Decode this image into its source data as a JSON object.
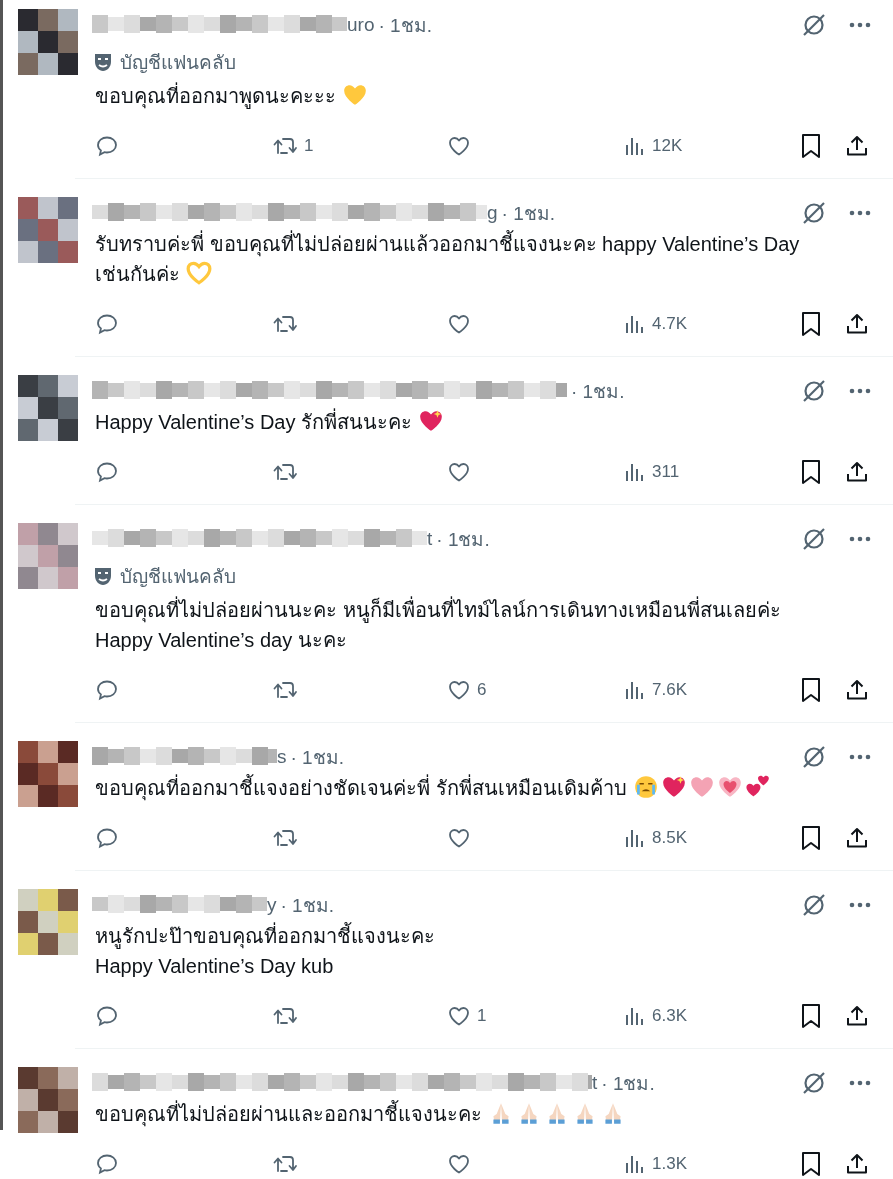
{
  "replies": [
    {
      "name_tail": "uro",
      "time": "· 1ชม.",
      "badge": "บัญชีแฟนคลับ",
      "lines": [
        "ขอบคุณที่ออกมาพูดนะคะะะ"
      ],
      "emoji": [
        {
          "kind": "heart",
          "color": "#ffc83d"
        }
      ],
      "reposts": "1",
      "views": "12K"
    },
    {
      "name_tail": "g",
      "time": "· 1ชม.",
      "lines": [
        "รับทราบค่ะพี่ ขอบคุณที่ไม่ปล่อยผ่านแล้วออกมาชี้แจงนะคะ happy Valentine’s Day",
        "เช่นกันค่ะ"
      ],
      "emoji": [
        {
          "kind": "heart-hands",
          "color": "#ffc83d"
        }
      ],
      "views": "4.7K"
    },
    {
      "time": "· 1ชม.",
      "lines": [
        "Happy Valentine’s Day รักพี่สนนะคะ"
      ],
      "emoji": [
        {
          "kind": "sparkle-heart",
          "color": "#e0245e"
        }
      ],
      "views": "311"
    },
    {
      "name_tail": "t",
      "time": "· 1ชม.",
      "badge": "บัญชีแฟนคลับ",
      "lines": [
        "ขอบคุณที่ไม่ปล่อยผ่านนะคะ หนูก็มีเพื่อนที่ไทม์ไลน์การเดินทางเหมือนพี่สนเลยค่ะ",
        "Happy Valentine’s day นะคะ"
      ],
      "likes": "6",
      "views": "7.6K"
    },
    {
      "name_tail": "s",
      "time": "· 1ชม.",
      "lines": [
        "ขอบคุณที่ออกมาชี้แจงอย่างชัดเจนค่ะพี่ รักพี่สนเหมือนเดิมค้าบ"
      ],
      "emoji": [
        {
          "kind": "crying-face",
          "color": "#ffc83d"
        },
        {
          "kind": "sparkle-heart",
          "color": "#e0245e"
        },
        {
          "kind": "heart",
          "color": "#f4a3b4"
        },
        {
          "kind": "glow-heart",
          "color": "#e8506e"
        },
        {
          "kind": "two-hearts",
          "color": "#e0245e"
        }
      ],
      "views": "8.5K"
    },
    {
      "name_tail": "y",
      "time": "· 1ชม.",
      "lines": [
        "หนูรักปะป๊าขอบคุณที่ออกมาชี้แจงนะคะ",
        "Happy Valentine’s Day kub"
      ],
      "likes": "1",
      "views": "6.3K"
    },
    {
      "name_tail": "t",
      "time": "· 1ชม.",
      "lines": [
        "ขอบคุณที่ไม่ปล่อยผ่านและออกมาชี้แจงนะคะ"
      ],
      "emoji": [
        {
          "kind": "folded-hands",
          "color": "#f5d6c0"
        },
        {
          "kind": "folded-hands",
          "color": "#f5d6c0"
        },
        {
          "kind": "folded-hands",
          "color": "#f5d6c0"
        },
        {
          "kind": "folded-hands",
          "color": "#f5d6c0"
        },
        {
          "kind": "folded-hands",
          "color": "#f5d6c0"
        }
      ],
      "views": "1.3K"
    }
  ]
}
